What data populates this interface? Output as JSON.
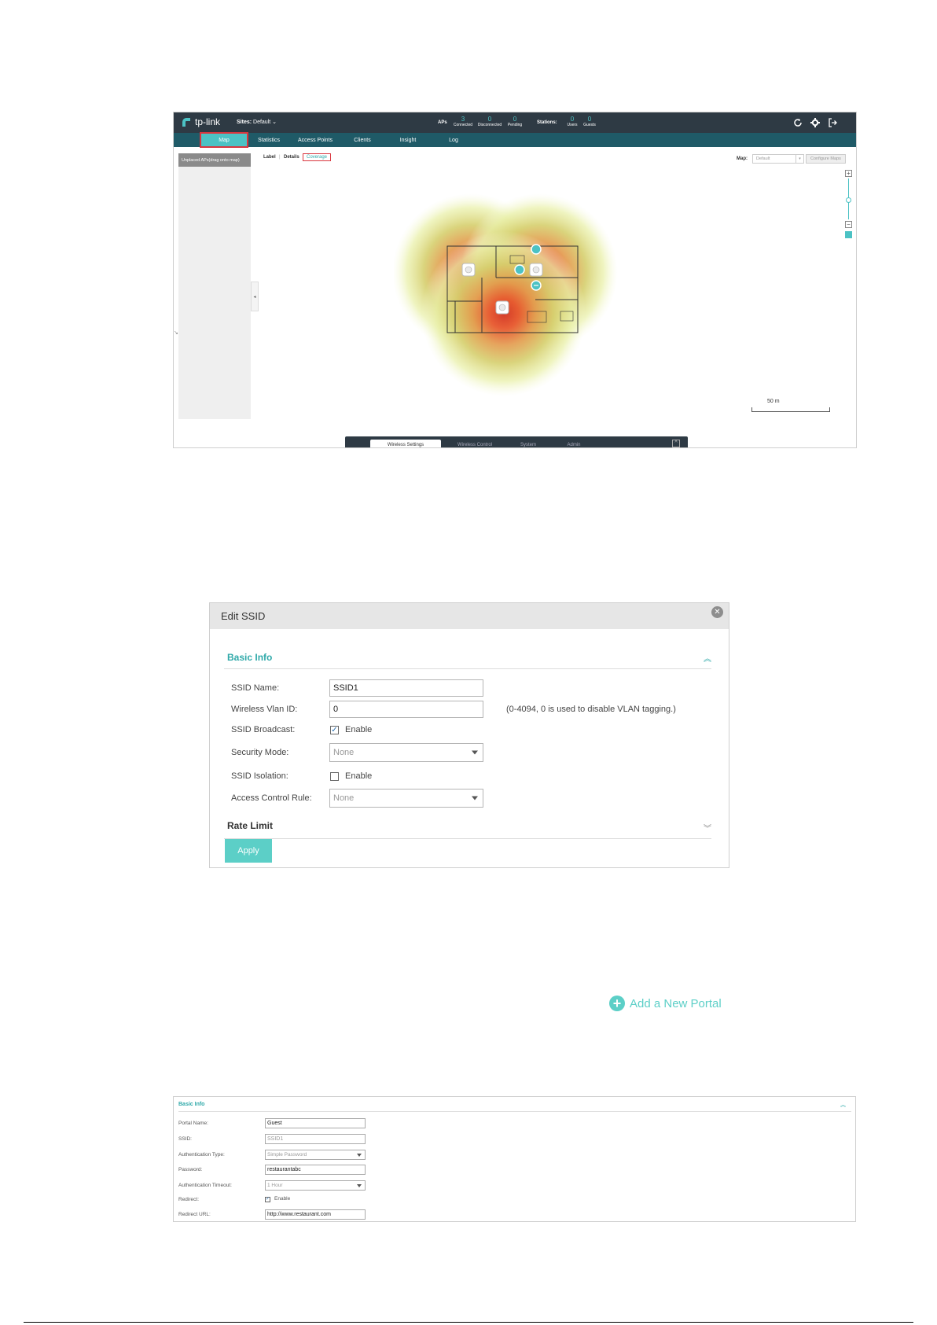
{
  "shot1": {
    "logo_text": "tp-link",
    "sites_label": "Sites:",
    "sites_value": "Default",
    "aps_label": "APs",
    "aps": [
      {
        "count": "3",
        "label": "Connected"
      },
      {
        "count": "0",
        "label": "Disconnected"
      },
      {
        "count": "0",
        "label": "Pending"
      }
    ],
    "stations_label": "Stations:",
    "stations": [
      {
        "count": "0",
        "label": "Users"
      },
      {
        "count": "0",
        "label": "Guests"
      }
    ],
    "top_icons": [
      "refresh-icon",
      "gear-icon",
      "logout-icon"
    ],
    "nav": [
      "Map",
      "Statistics",
      "Access Points",
      "Clients",
      "Insight",
      "Log"
    ],
    "nav_active": "Map",
    "unplaced_label": "Unplaced APs(drag onto map)",
    "view_tabs": {
      "label": "Label",
      "details": "Details",
      "coverage": "Coverage"
    },
    "map_label": "Map:",
    "map_select": "Default",
    "configure_maps": "Configure Maps",
    "zoom_in": "+",
    "zoom_out": "−",
    "scale_label": "50 m",
    "bottom_tabs": [
      "Wireless Settings",
      "Wireless Control",
      "System",
      "Admin"
    ],
    "bottom_active": "Wireless Settings",
    "colors": {
      "topbar": "#2e3a44",
      "navbar": "#1f5a67",
      "accent": "#4cc2c4",
      "highlight": "#d9363e"
    }
  },
  "edit_ssid": {
    "title": "Edit SSID",
    "basic_info": "Basic Info",
    "rate_limit": "Rate Limit",
    "fields": {
      "ssid_name": {
        "label": "SSID Name:",
        "value": "SSID1"
      },
      "vlan_id": {
        "label": "Wireless Vlan ID:",
        "value": "0",
        "hint": "(0-4094, 0 is used to disable VLAN tagging.)"
      },
      "broadcast": {
        "label": "SSID Broadcast:",
        "checkbox": "Enable",
        "checked": true
      },
      "security_mode": {
        "label": "Security Mode:",
        "value": "None"
      },
      "isolation": {
        "label": "SSID Isolation:",
        "checkbox": "Enable",
        "checked": false
      },
      "access_control": {
        "label": "Access Control Rule:",
        "value": "None"
      }
    },
    "apply": "Apply",
    "colors": {
      "accent": "#5ccfc7",
      "section_title": "#2fa9a9"
    }
  },
  "add_portal": {
    "label": "Add a New Portal"
  },
  "portal_form": {
    "title": "Basic Info",
    "fields": {
      "portal_name": {
        "label": "Portal Name:",
        "value": "Guest"
      },
      "ssid": {
        "label": "SSID:",
        "value": "SSID1"
      },
      "auth_type": {
        "label": "Authentication Type:",
        "value": "Simple Password"
      },
      "password": {
        "label": "Password:",
        "value": "restaurantabc"
      },
      "auth_timeout": {
        "label": "Authentication Timeout:",
        "value": "1 Hour"
      },
      "redirect": {
        "label": "Redirect:",
        "checkbox": "Enable",
        "checked": true
      },
      "redirect_url": {
        "label": "Redirect URL:",
        "value": "http://www.restaurant.com"
      }
    }
  }
}
